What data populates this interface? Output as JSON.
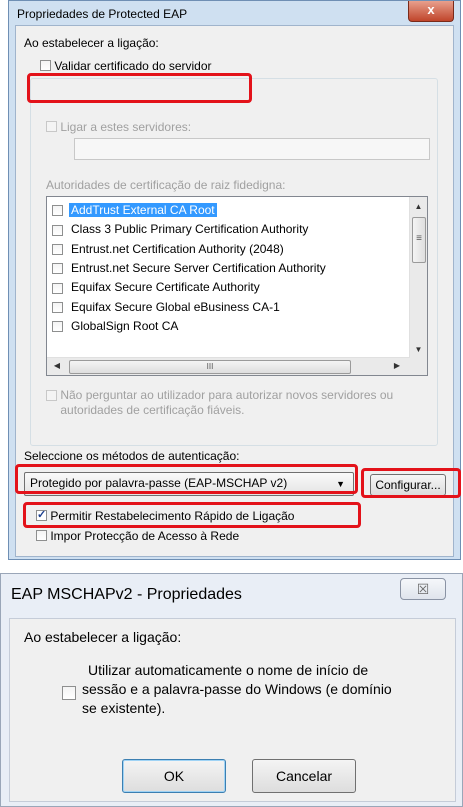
{
  "dialog1": {
    "title": "Propriedades de Protected EAP",
    "close_label": "x",
    "when_connecting_label": "Ao estabelecer a ligação:",
    "validate_cert_label": "Validar certificado do servidor",
    "connect_servers_label": "Ligar a estes servidores:",
    "servers_value": "",
    "root_ca_label": "Autoridades de certificação de raiz fidedigna:",
    "ca_list": [
      "AddTrust External CA Root",
      "Class 3 Public Primary Certification Authority",
      "Entrust.net Certification Authority (2048)",
      "Entrust.net Secure Server Certification Authority",
      "Equifax Secure Certificate Authority",
      "Equifax Secure Global eBusiness CA-1",
      "GlobalSign Root CA"
    ],
    "no_prompt_label_line1": "Não perguntar ao utilizador para autorizar novos servidores ou",
    "no_prompt_label_line2": "autoridades de certificação fiáveis.",
    "auth_method_label": "Seleccione os métodos de autenticação:",
    "auth_method_value": "Protegido por palavra-passe (EAP-MSCHAP v2)",
    "configure_label": "Configurar...",
    "fast_reconnect_label": "Permitir Restabelecimento Rápido de Ligação",
    "nap_label": "Impor Protecção de Acesso à Rede",
    "scroll_thumb_glyph": "≡",
    "hscroll_thumb_glyph": "III"
  },
  "dialog2": {
    "title": "EAP MSCHAPv2 - Propriedades",
    "close_label": "☒",
    "when_connecting_label": "Ao estabelecer a ligação:",
    "auto_logon_line1": "Utilizar automaticamente o nome de início de",
    "auto_logon_line2": "sessão e a palavra-passe do Windows (e domínio",
    "auto_logon_line3": "se existente).",
    "ok_label": "OK",
    "cancel_label": "Cancelar"
  }
}
